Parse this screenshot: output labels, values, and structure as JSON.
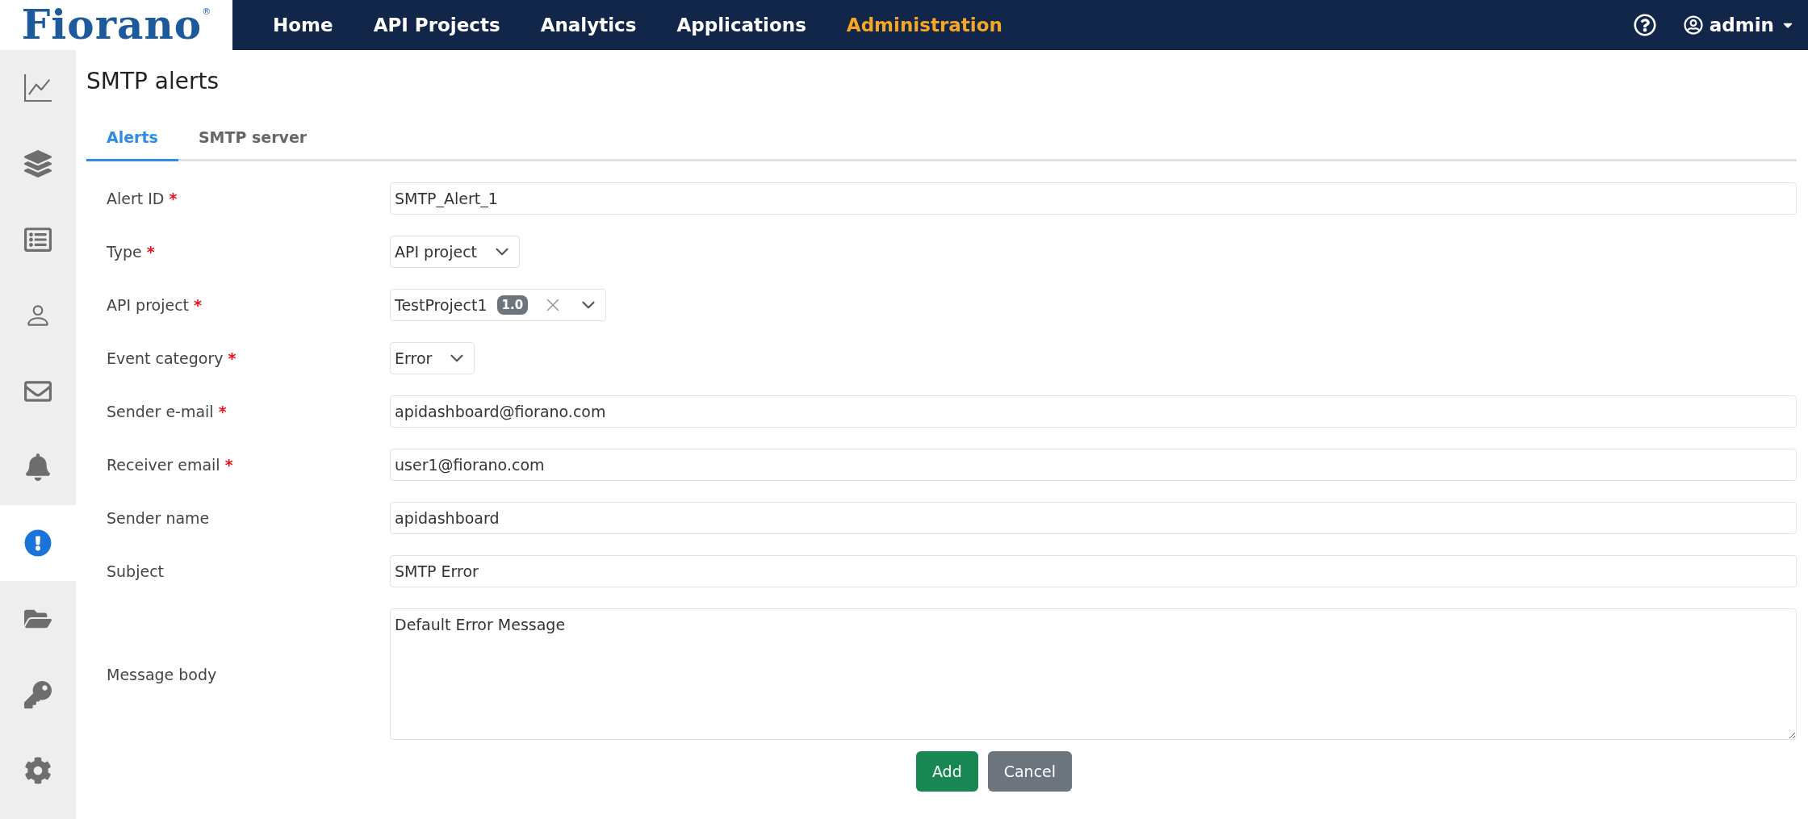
{
  "logo": {
    "text": "Fiorano",
    "mark": "®"
  },
  "nav": [
    {
      "label": "Home",
      "selected": false
    },
    {
      "label": "API Projects",
      "selected": false
    },
    {
      "label": "Analytics",
      "selected": false
    },
    {
      "label": "Applications",
      "selected": false
    },
    {
      "label": "Administration",
      "selected": true
    }
  ],
  "user": {
    "name": "admin"
  },
  "sidebar": {
    "items": [
      {
        "selected": false
      },
      {
        "selected": false
      },
      {
        "selected": false
      },
      {
        "selected": false
      },
      {
        "selected": false
      },
      {
        "selected": false
      },
      {
        "selected": true
      },
      {
        "selected": false
      },
      {
        "selected": false
      },
      {
        "selected": false
      }
    ]
  },
  "page_title": "SMTP alerts",
  "tabs": [
    {
      "label": "Alerts",
      "selected": true
    },
    {
      "label": "SMTP server",
      "selected": false
    }
  ],
  "fields": [
    {
      "label": "Alert ID",
      "required_mark": "*",
      "kind": "text",
      "value": "SMTP_Alert_1"
    },
    {
      "label": "Type",
      "required_mark": "*",
      "kind": "select",
      "value": "API project"
    },
    {
      "label": "API project",
      "required_mark": "*",
      "kind": "tag_select",
      "value": "TestProject1",
      "badge": "1.0"
    },
    {
      "label": "Event category",
      "required_mark": "*",
      "kind": "select",
      "value": "Error"
    },
    {
      "label": "Sender e-mail",
      "required_mark": "*",
      "kind": "text",
      "value": "apidashboard@fiorano.com"
    },
    {
      "label": "Receiver email",
      "required_mark": "*",
      "kind": "text",
      "value": "user1@fiorano.com"
    },
    {
      "label": "Sender name",
      "kind": "text",
      "value": "apidashboard"
    },
    {
      "label": "Subject",
      "kind": "text",
      "value": "SMTP Error"
    },
    {
      "label": "Message body",
      "kind": "textarea",
      "value": "Default Error Message"
    }
  ],
  "buttons": [
    {
      "label": "Add",
      "kind": "primary"
    },
    {
      "label": "Cancel",
      "kind": "secondary"
    }
  ]
}
